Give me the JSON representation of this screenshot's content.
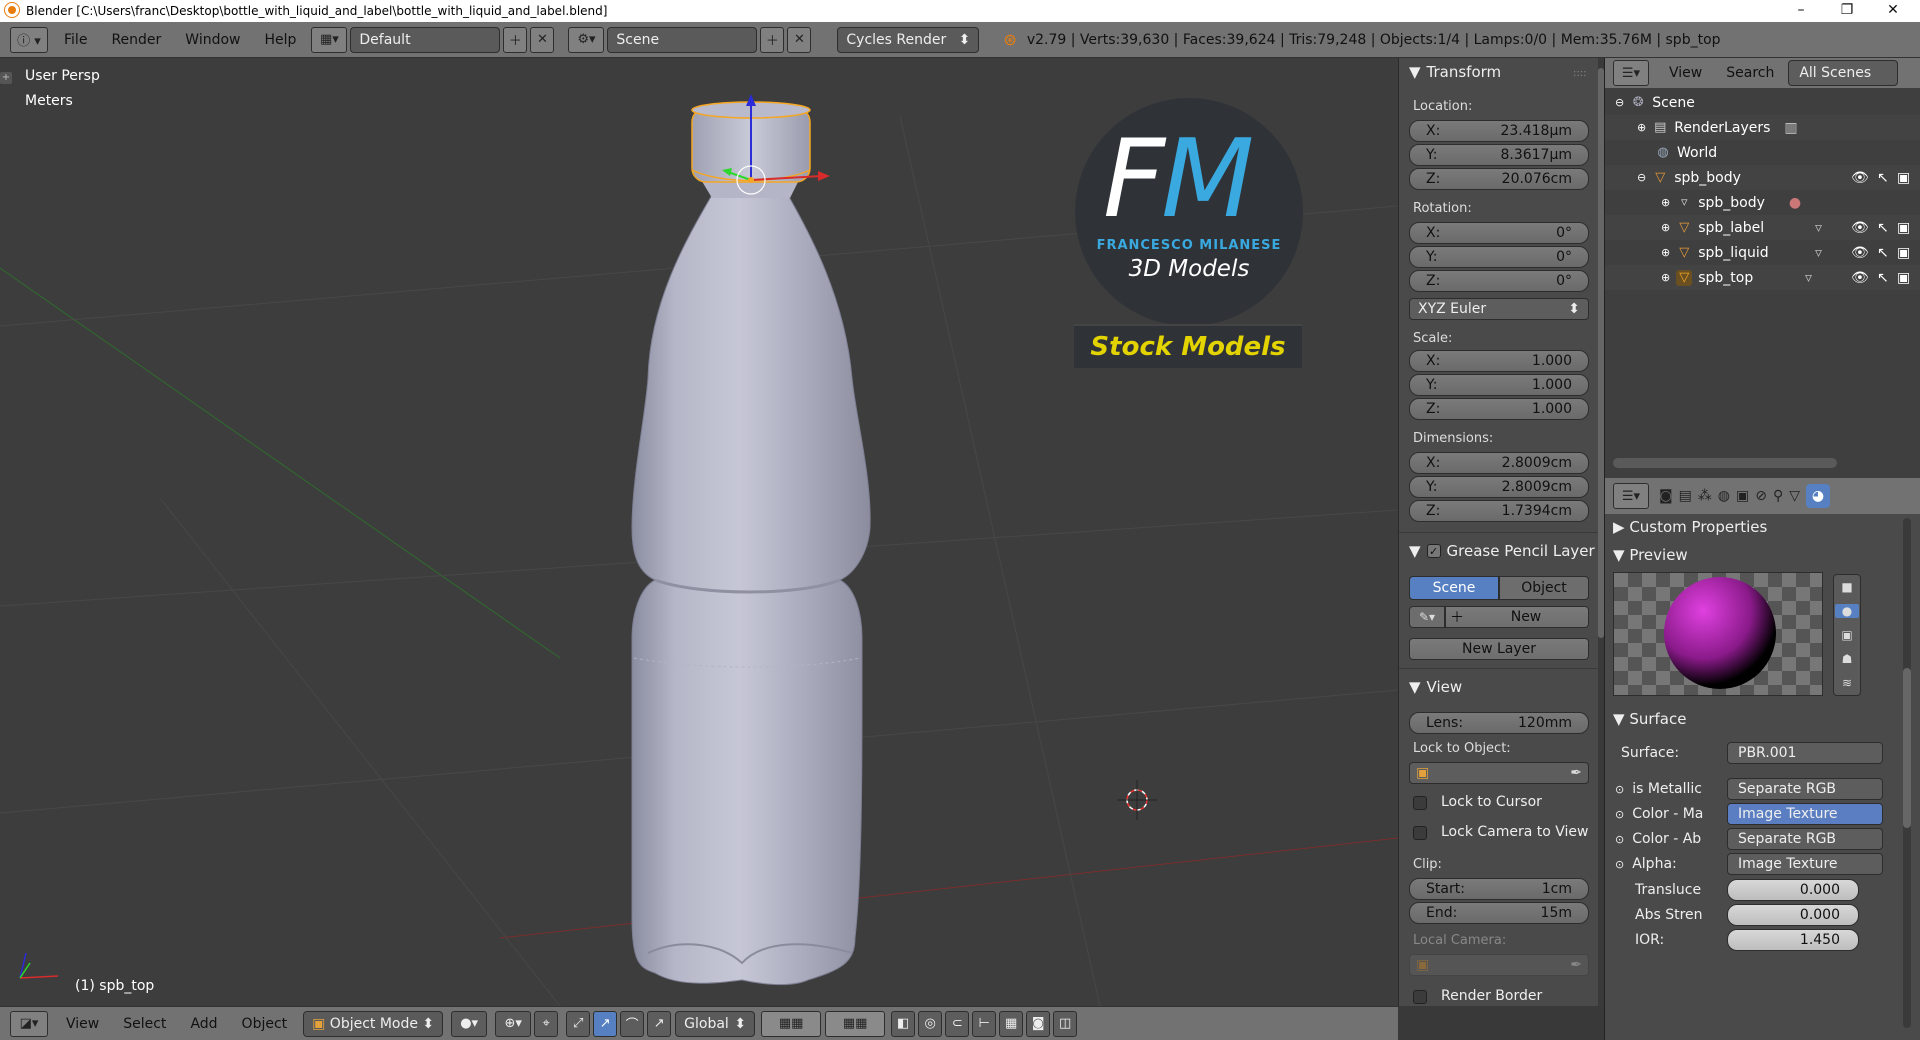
{
  "window": {
    "title": "Blender [C:\\Users\\franc\\Desktop\\bottle_with_liquid_and_label\\bottle_with_liquid_and_label.blend]",
    "minimize": "–",
    "maximize": "❐",
    "close": "✕"
  },
  "infobar": {
    "menus": [
      "File",
      "Render",
      "Window",
      "Help"
    ],
    "layout": "Default",
    "scene": "Scene",
    "engine": "Cycles Render",
    "stats": "v2.79 | Verts:39,630 | Faces:39,624 | Tris:79,248 | Objects:1/4 | Lamps:0/0 | Mem:35.76M | spb_top"
  },
  "viewport": {
    "view_name": "User Persp",
    "units": "Meters",
    "active_object": "(1) spb_top",
    "watermark": {
      "logo": "FM",
      "brand": "FRANCESCO MILANESE",
      "tagline": "3D Models",
      "banner": "Stock Models"
    }
  },
  "npanel": {
    "transform": {
      "title": "Transform",
      "location_label": "Location:",
      "location": [
        {
          "axis": "X:",
          "value": "23.418µm"
        },
        {
          "axis": "Y:",
          "value": "8.3617µm"
        },
        {
          "axis": "Z:",
          "value": "20.076cm"
        }
      ],
      "rotation_label": "Rotation:",
      "rotation": [
        {
          "axis": "X:",
          "value": "0°"
        },
        {
          "axis": "Y:",
          "value": "0°"
        },
        {
          "axis": "Z:",
          "value": "0°"
        }
      ],
      "rotation_mode": "XYZ Euler",
      "scale_label": "Scale:",
      "scale": [
        {
          "axis": "X:",
          "value": "1.000"
        },
        {
          "axis": "Y:",
          "value": "1.000"
        },
        {
          "axis": "Z:",
          "value": "1.000"
        }
      ],
      "dimensions_label": "Dimensions:",
      "dimensions": [
        {
          "axis": "X:",
          "value": "2.8009cm"
        },
        {
          "axis": "Y:",
          "value": "2.8009cm"
        },
        {
          "axis": "Z:",
          "value": "1.7394cm"
        }
      ]
    },
    "grease_pencil": {
      "title": "Grease Pencil Layer",
      "scene_tab": "Scene",
      "object_tab": "Object",
      "new_button": "New",
      "new_layer_button": "New Layer"
    },
    "view": {
      "title": "View",
      "lens_label": "Lens:",
      "lens_value": "120mm",
      "lock_object_label": "Lock to Object:",
      "lock_cursor": "Lock to Cursor",
      "lock_camera": "Lock Camera to View",
      "clip_label": "Clip:",
      "clip_start_label": "Start:",
      "clip_start": "1cm",
      "clip_end_label": "End:",
      "clip_end": "15m",
      "local_camera_label": "Local Camera:",
      "render_border": "Render Border"
    }
  },
  "outliner": {
    "menus": [
      "View",
      "Search"
    ],
    "filter": "All Scenes",
    "items": [
      {
        "name": "Scene"
      },
      {
        "name": "RenderLayers"
      },
      {
        "name": "World"
      },
      {
        "name": "spb_body"
      },
      {
        "name": "spb_body"
      },
      {
        "name": "spb_label"
      },
      {
        "name": "spb_liquid"
      },
      {
        "name": "spb_top"
      }
    ]
  },
  "properties": {
    "custom_props": "Custom Properties",
    "preview": "Preview",
    "surface_header": "Surface",
    "surface_label": "Surface:",
    "surface_value": "PBR.001",
    "rows": [
      {
        "label": "is Metallic",
        "value": "Separate RGB"
      },
      {
        "label": "Color - Ma",
        "value": "Image Texture"
      },
      {
        "label": "Color - Ab",
        "value": "Separate RGB"
      },
      {
        "label": "Alpha:",
        "value": "Image Texture"
      }
    ],
    "sliders": [
      {
        "label": "Transluce",
        "value": "0.000"
      },
      {
        "label": "Abs Stren",
        "value": "0.000"
      },
      {
        "label": "IOR:",
        "value": "1.450"
      }
    ]
  },
  "bottombar": {
    "menus": [
      "View",
      "Select",
      "Add",
      "Object"
    ],
    "mode": "Object Mode",
    "orientation": "Global"
  },
  "colors": {
    "accent_blue": "#5680c2",
    "selection_orange": "#f5a623",
    "viewport_bg": "#3d3d3d",
    "watermark_blue": "#39a9e0",
    "banner_yellow": "#e3d300"
  }
}
